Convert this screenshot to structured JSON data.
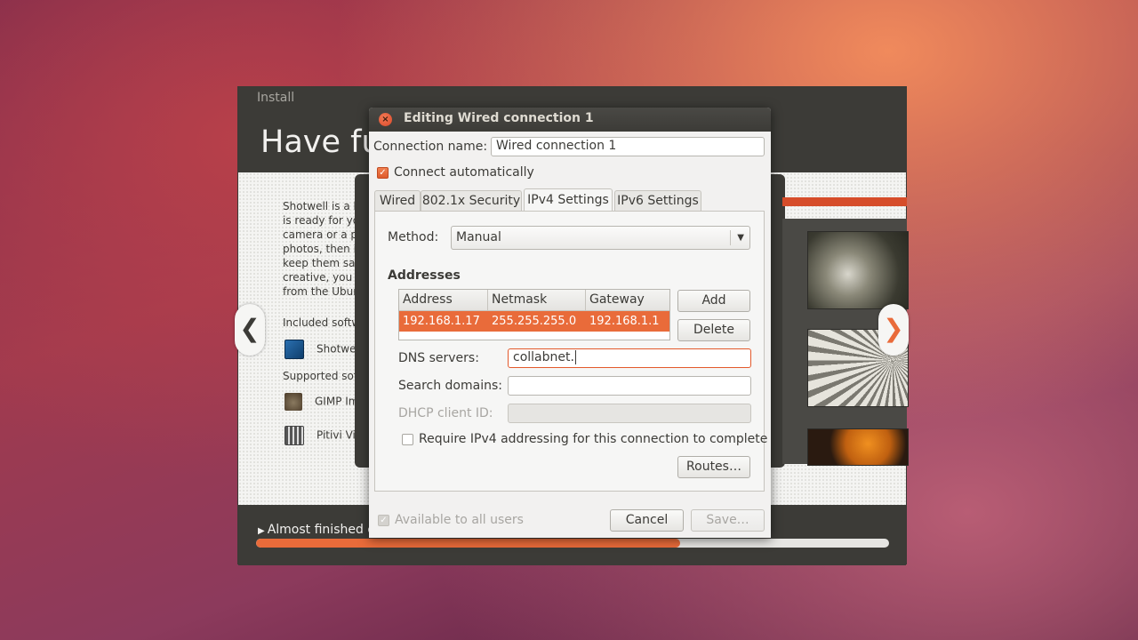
{
  "installer": {
    "label": "Install",
    "title": "Have fun",
    "slide_text": [
      "Shotwell is a handy",
      "is ready for you",
      "camera or a phone",
      "photos, then it",
      "keep them safe",
      "creative, you can",
      "from the Ubuntu"
    ],
    "included_label": "Included software",
    "included_items": [
      {
        "icon": "shotwell-icon",
        "label": "Shotwell"
      }
    ],
    "supported_label": "Supported software",
    "supported_items": [
      {
        "icon": "gimp-icon",
        "label": "GIMP Image"
      },
      {
        "icon": "pitivi-icon",
        "label": "Pitivi Video"
      }
    ],
    "prev_glyph": "❮",
    "next_glyph": "❯",
    "footer_text": "Almost finished copying files",
    "progress": 0.67,
    "accent": "#e96b3a"
  },
  "dialog": {
    "title": "Editing Wired connection 1",
    "close_glyph": "×",
    "connection_name_label": "Connection name:",
    "connection_name_value": "Wired connection 1",
    "connect_auto_label": "Connect automatically",
    "connect_auto_checked": true,
    "tabs": [
      {
        "label": "Wired",
        "active": false
      },
      {
        "label": "802.1x Security",
        "active": false
      },
      {
        "label": "IPv4 Settings",
        "active": true
      },
      {
        "label": "IPv6 Settings",
        "active": false
      }
    ],
    "method_label": "Method:",
    "method_value": "Manual",
    "addresses_heading": "Addresses",
    "table": {
      "columns": [
        "Address",
        "Netmask",
        "Gateway"
      ],
      "rows": [
        [
          "192.168.1.17",
          "255.255.255.0",
          "192.168.1.1"
        ]
      ]
    },
    "add_label": "Add",
    "delete_label": "Delete",
    "dns_label": "DNS servers:",
    "dns_value": "collabnet.",
    "search_label": "Search domains:",
    "search_value": "",
    "dhcp_label": "DHCP client ID:",
    "dhcp_value": "",
    "require_label": "Require IPv4 addressing for this connection to complete",
    "require_checked": false,
    "routes_label": "Routes…",
    "available_label": "Available to all users",
    "available_checked": true,
    "cancel_label": "Cancel",
    "save_label": "Save…"
  }
}
